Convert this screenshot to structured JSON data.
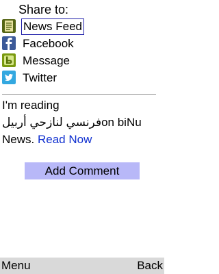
{
  "share": {
    "title": "Share to:",
    "items": [
      {
        "label": "News Feed",
        "icon": "newsfeed-icon",
        "color": "#6b7d1f",
        "focused": true
      },
      {
        "label": "Facebook",
        "icon": "facebook-icon",
        "color": "#3b5998"
      },
      {
        "label": "Message",
        "icon": "message-icon",
        "color": "#7a9a10"
      },
      {
        "label": "Twitter",
        "icon": "twitter-icon",
        "color": "#33a8e0"
      }
    ]
  },
  "message": {
    "line1": "I'm reading",
    "line2_arabic": "فرنسي لنازحي أربيل",
    "line2_suffix": "on biNu",
    "line3_prefix": "News.",
    "read_now": "Read Now"
  },
  "add_comment_label": "Add Comment",
  "softkeys": {
    "left": "Menu",
    "right": "Back"
  },
  "colors": {
    "link": "#1030d0",
    "button_bg": "#b8b8f8",
    "focus_border": "#1c1ca8",
    "softkey_bg": "#d9d9d9"
  }
}
